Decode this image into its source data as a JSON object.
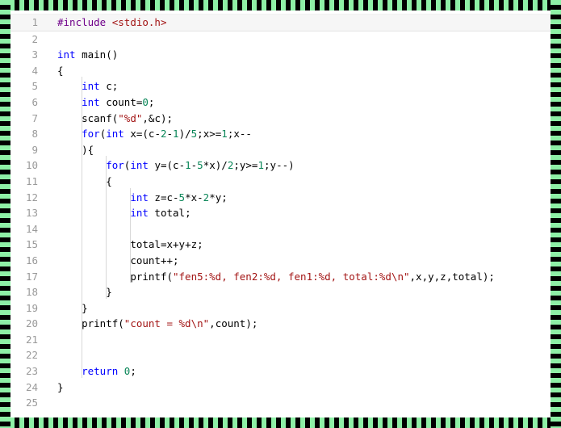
{
  "frame": {
    "style": "striped-border",
    "colors": {
      "stripe_green": "#8ef0a6",
      "stripe_black": "#000000"
    },
    "band_thickness_px": 13
  },
  "editor": {
    "background": "#ffffff",
    "language": "c",
    "current_line": 1,
    "gutter": {
      "text_color": "#9a9a9a",
      "line_numbers": [
        "1",
        "2",
        "3",
        "4",
        "5",
        "6",
        "7",
        "8",
        "9",
        "10",
        "11",
        "12",
        "13",
        "14",
        "15",
        "16",
        "17",
        "18",
        "19",
        "20",
        "21",
        "22",
        "23",
        "24",
        "25"
      ]
    },
    "syntax_colors": {
      "keyword": "#0000ff",
      "number": "#098658",
      "string": "#a31515",
      "preprocessor": "#6f008a",
      "include_path": "#a31515",
      "plain": "#000000"
    },
    "lines": [
      {
        "n": "1",
        "text": "#include <stdio.h>"
      },
      {
        "n": "2",
        "text": ""
      },
      {
        "n": "3",
        "text": "int main()"
      },
      {
        "n": "4",
        "text": "{"
      },
      {
        "n": "5",
        "text": "    int c;"
      },
      {
        "n": "6",
        "text": "    int count=0;"
      },
      {
        "n": "7",
        "text": "    scanf(\"%d\",&c);"
      },
      {
        "n": "8",
        "text": "    for(int x=(c-2-1)/5;x>=1;x--"
      },
      {
        "n": "9",
        "text": "    ){"
      },
      {
        "n": "10",
        "text": "        for(int y=(c-1-5*x)/2;y>=1;y--)"
      },
      {
        "n": "11",
        "text": "        {"
      },
      {
        "n": "12",
        "text": "            int z=c-5*x-2*y;"
      },
      {
        "n": "13",
        "text": "            int total;"
      },
      {
        "n": "14",
        "text": ""
      },
      {
        "n": "15",
        "text": "            total=x+y+z;"
      },
      {
        "n": "16",
        "text": "            count++;"
      },
      {
        "n": "17",
        "text": "            printf(\"fen5:%d, fen2:%d, fen1:%d, total:%d\\n\",x,y,z,total);"
      },
      {
        "n": "18",
        "text": "        }"
      },
      {
        "n": "19",
        "text": "    }"
      },
      {
        "n": "20",
        "text": "    printf(\"count = %d\\n\",count);"
      },
      {
        "n": "21",
        "text": ""
      },
      {
        "n": "22",
        "text": ""
      },
      {
        "n": "23",
        "text": "    return 0;"
      },
      {
        "n": "24",
        "text": "}"
      },
      {
        "n": "25",
        "text": ""
      }
    ]
  }
}
